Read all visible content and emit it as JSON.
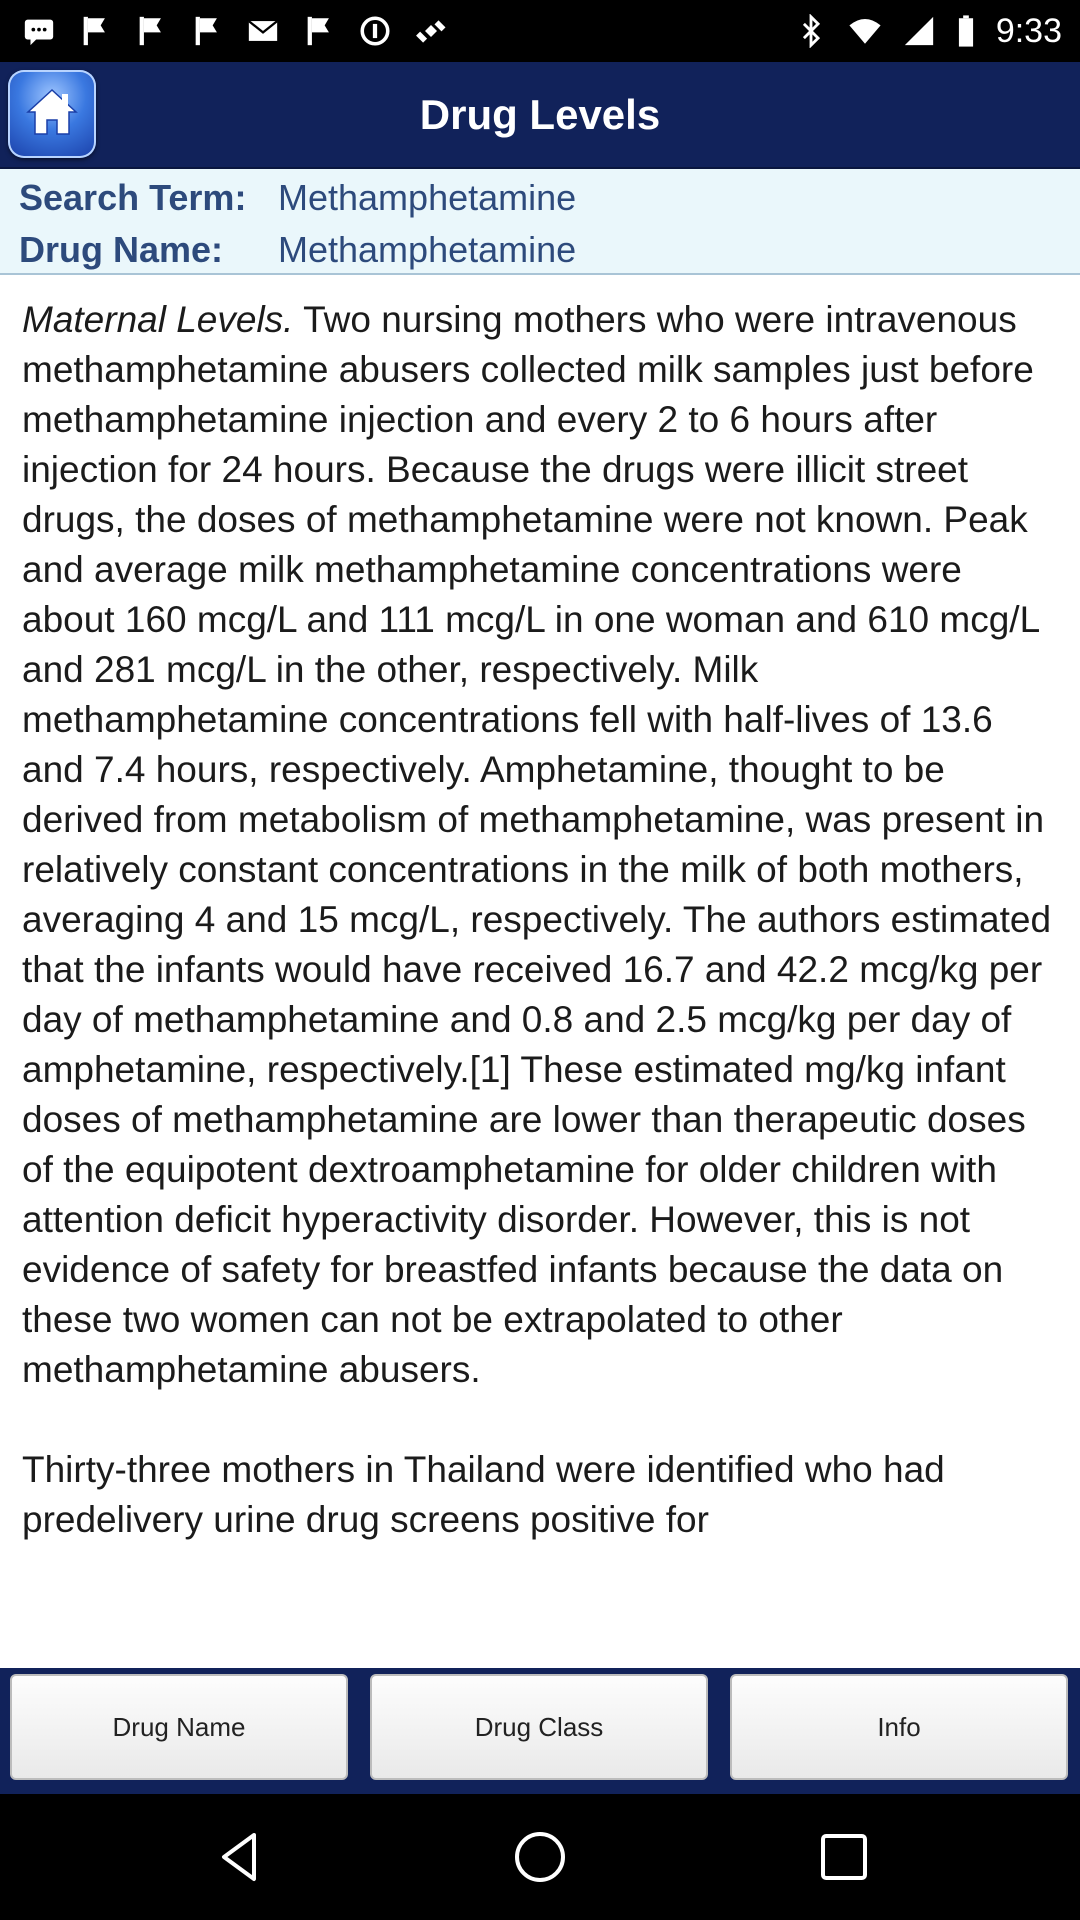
{
  "status_bar": {
    "time": "9:33",
    "left_icons": [
      "chat-icon",
      "flag-icon",
      "flag-icon",
      "flag-icon",
      "mail-icon",
      "flag-icon",
      "data-saver-icon",
      "satellite-icon"
    ],
    "right_icons": [
      "bluetooth-icon",
      "wifi-icon",
      "signal-icon",
      "battery-icon"
    ]
  },
  "header": {
    "title": "Drug Levels",
    "home_icon": "home-icon",
    "background": "#11225a"
  },
  "search_info": {
    "search_term_label": "Search Term:",
    "search_term_value": "Methamphetamine",
    "drug_name_label": "Drug Name:",
    "drug_name_value": "Methamphetamine"
  },
  "content": {
    "heading_italic": "Maternal Levels.",
    "paragraph_1": " Two nursing mothers who were intravenous methamphetamine abusers collected milk samples just before methamphetamine injection and every 2 to 6 hours after injection for 24 hours. Because the drugs were illicit street drugs, the doses of methamphetamine were not known. Peak and average milk methamphetamine concentrations were about 160 mcg/L and 111 mcg/L in one woman and 610 mcg/L and 281 mcg/L in the other, respectively. Milk methamphetamine concentrations fell with half-lives of 13.6 and 7.4 hours, respectively. Amphetamine, thought to be derived from metabolism of methamphetamine, was present in relatively constant concentrations in the milk of both mothers, averaging 4 and 15 mcg/L, respectively. The authors estimated that the infants would have received 16.7 and 42.2 mcg/kg per day of methamphetamine and 0.8 and 2.5 mcg/kg per day of amphetamine, respectively.[1] These estimated mg/kg infant doses of methamphetamine are lower than therapeutic doses of the equipotent dextroamphetamine for older children with attention deficit hyperactivity disorder. However, this is not evidence of safety for breastfed infants because the data on these two women can not be extrapolated to other methamphetamine abusers.",
    "paragraph_2": "Thirty-three mothers in Thailand were identified who had predelivery urine drug screens positive for"
  },
  "tabs": [
    {
      "label": "Drug Name"
    },
    {
      "label": "Drug Class"
    },
    {
      "label": "Info"
    }
  ],
  "nav": {
    "back_icon": "back-icon",
    "home_icon": "home-circle-icon",
    "recents_icon": "recents-icon"
  }
}
